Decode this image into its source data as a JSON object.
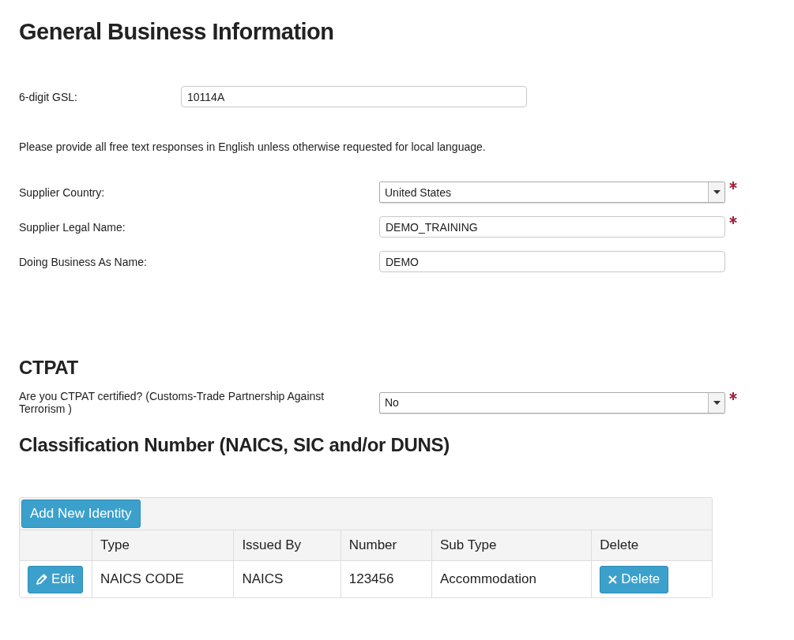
{
  "title": "General Business Information",
  "gsl": {
    "label": "6-digit GSL:",
    "value": "10114A"
  },
  "notice": "Please provide all free text responses in English unless otherwise requested for local language.",
  "fields": [
    {
      "kind": "select",
      "label": "Supplier Country:",
      "value": "United States",
      "required": true
    },
    {
      "kind": "text",
      "label": "Supplier Legal Name:",
      "value": "DEMO_TRAINING",
      "required": true
    },
    {
      "kind": "text",
      "label": "Doing Business As Name:",
      "value": "DEMO",
      "required": false
    }
  ],
  "ctpat": {
    "heading": "CTPAT",
    "question": "Are you CTPAT certified? (Customs-Trade Partnership Against Terrorism )",
    "value": "No",
    "required": true
  },
  "classification": {
    "heading": "Classification Number (NAICS, SIC and/or DUNS)",
    "add_button": "Add New Identity",
    "columns": [
      "Type",
      "Issued By",
      "Number",
      "Sub Type",
      "Delete"
    ],
    "rows": [
      {
        "edit": "Edit",
        "type": "NAICS CODE",
        "issued_by": "NAICS",
        "number": "123456",
        "sub_type": "Accommodation",
        "delete": "Delete"
      }
    ]
  }
}
